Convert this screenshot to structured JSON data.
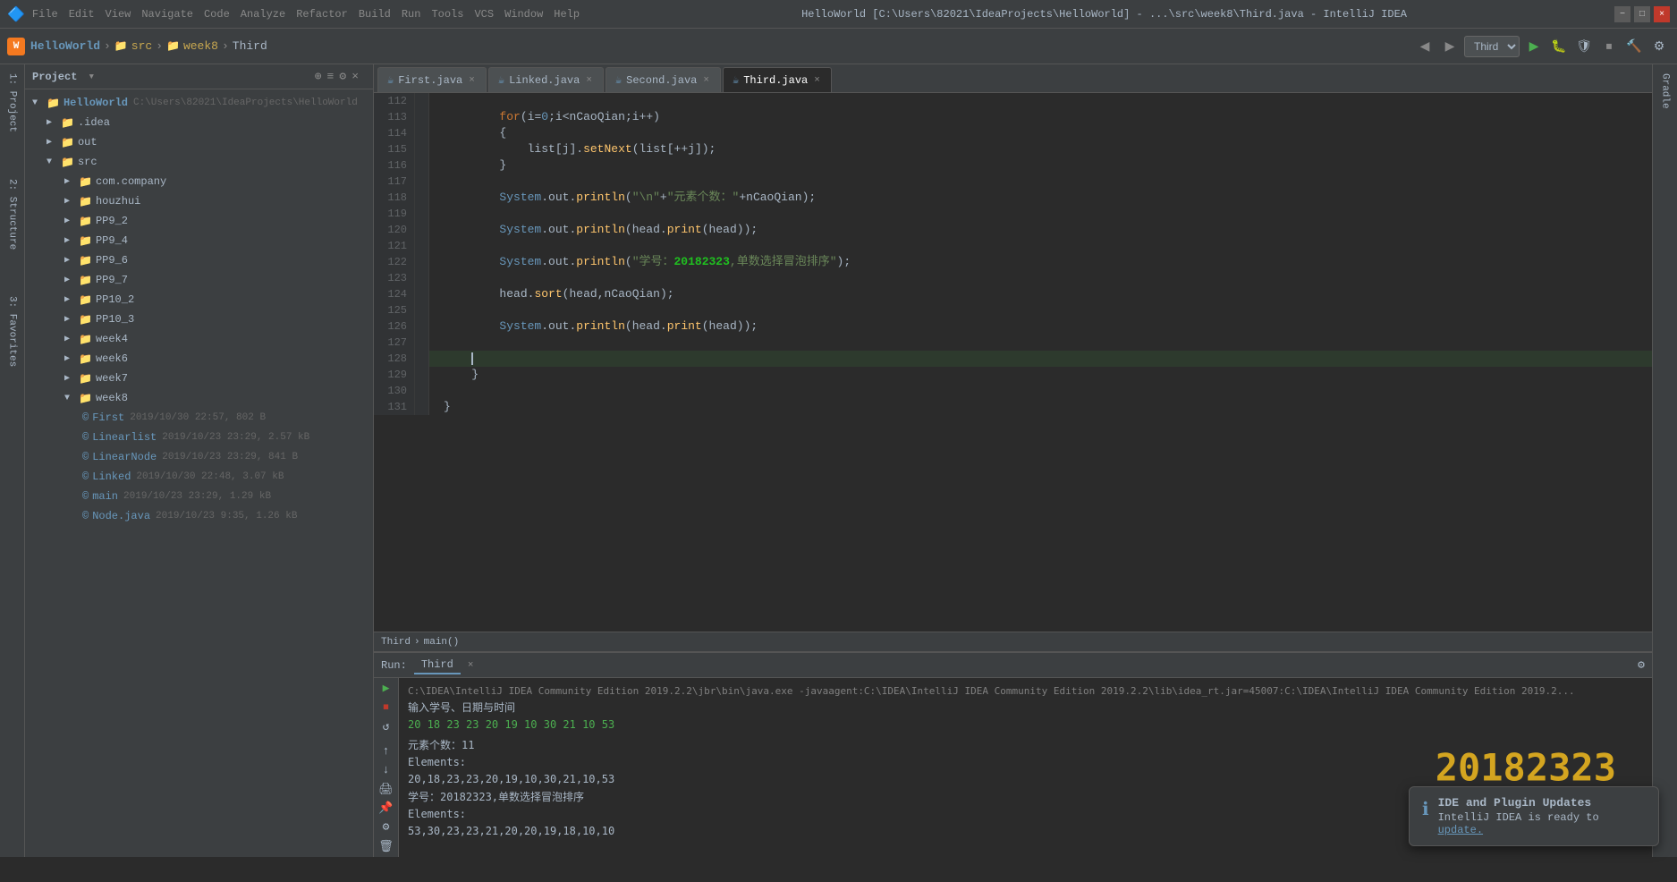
{
  "titlebar": {
    "title": "HelloWorld [C:\\Users\\82021\\IdeaProjects\\HelloWorld] - ...\\src\\week8\\Third.java - IntelliJ IDEA",
    "minimize": "−",
    "maximize": "□",
    "close": "×"
  },
  "toolbar": {
    "app_name": "HelloWorld",
    "breadcrumb": [
      "src",
      "week8",
      "Third"
    ],
    "run_config": "Third",
    "menu": [
      "File",
      "Edit",
      "View",
      "Navigate",
      "Code",
      "Analyze",
      "Refactor",
      "Build",
      "Run",
      "Tools",
      "VCS",
      "Window",
      "Help"
    ]
  },
  "sidebar": {
    "title": "Project",
    "tree": [
      {
        "level": 0,
        "type": "root",
        "label": "HelloWorld",
        "sublabel": "C:\\Users\\82021\\IdeaProjects\\HelloWorld",
        "icon": "folder",
        "expanded": true
      },
      {
        "level": 1,
        "type": "folder",
        "label": ".idea",
        "icon": "folder",
        "expanded": false
      },
      {
        "level": 1,
        "type": "folder",
        "label": "out",
        "icon": "folder",
        "expanded": false
      },
      {
        "level": 1,
        "type": "folder",
        "label": "src",
        "icon": "folder",
        "expanded": true
      },
      {
        "level": 2,
        "type": "folder",
        "label": "com.company",
        "icon": "folder",
        "expanded": false
      },
      {
        "level": 2,
        "type": "folder",
        "label": "houzhui",
        "icon": "folder",
        "expanded": false
      },
      {
        "level": 2,
        "type": "folder",
        "label": "PP9_2",
        "icon": "folder",
        "expanded": false
      },
      {
        "level": 2,
        "type": "folder",
        "label": "PP9_4",
        "icon": "folder",
        "expanded": false
      },
      {
        "level": 2,
        "type": "folder",
        "label": "PP9_6",
        "icon": "folder",
        "expanded": false
      },
      {
        "level": 2,
        "type": "folder",
        "label": "PP9_7",
        "icon": "folder",
        "expanded": false
      },
      {
        "level": 2,
        "type": "folder",
        "label": "PP10_2",
        "icon": "folder",
        "expanded": false
      },
      {
        "level": 2,
        "type": "folder",
        "label": "PP10_3",
        "icon": "folder",
        "expanded": false
      },
      {
        "level": 2,
        "type": "folder",
        "label": "week4",
        "icon": "folder",
        "expanded": false
      },
      {
        "level": 2,
        "type": "folder",
        "label": "week6",
        "icon": "folder",
        "expanded": false
      },
      {
        "level": 2,
        "type": "folder",
        "label": "week7",
        "icon": "folder",
        "expanded": false
      },
      {
        "level": 2,
        "type": "folder",
        "label": "week8",
        "icon": "folder",
        "expanded": true
      },
      {
        "level": 3,
        "type": "class",
        "label": "First",
        "meta": "2019/10/30 22:57, 802 B",
        "color": "blue"
      },
      {
        "level": 3,
        "type": "class",
        "label": "Linearlist",
        "meta": "2019/10/23 23:29, 2.57 kB",
        "color": "blue"
      },
      {
        "level": 3,
        "type": "class",
        "label": "LinearNode",
        "meta": "2019/10/23 23:29, 841 B",
        "color": "blue"
      },
      {
        "level": 3,
        "type": "class",
        "label": "Linked",
        "meta": "2019/10/30 22:48, 3.07 kB",
        "color": "blue"
      },
      {
        "level": 3,
        "type": "class",
        "label": "main",
        "meta": "2019/10/23 23:29, 1.29 kB",
        "color": "blue"
      },
      {
        "level": 3,
        "type": "class",
        "label": "Node.java",
        "meta": "2019/10/23 9:35, 1.26 kB",
        "color": "blue"
      }
    ]
  },
  "tabs": [
    {
      "label": "First.java",
      "active": false,
      "color": "blue"
    },
    {
      "label": "Linked.java",
      "active": false,
      "color": "blue"
    },
    {
      "label": "Second.java",
      "active": false,
      "color": "blue"
    },
    {
      "label": "Third.java",
      "active": true,
      "color": "blue"
    }
  ],
  "code": {
    "lines": [
      {
        "num": 112,
        "content": "",
        "type": "blank"
      },
      {
        "num": 113,
        "content": "        for(i=0;i<nCaoQian;i++)",
        "type": "code"
      },
      {
        "num": 114,
        "content": "        {",
        "type": "code"
      },
      {
        "num": 115,
        "content": "            list[j].setNext(list[++j]);",
        "type": "code"
      },
      {
        "num": 116,
        "content": "        }",
        "type": "code"
      },
      {
        "num": 117,
        "content": "",
        "type": "blank"
      },
      {
        "num": 118,
        "content": "        System.out.println(\"\\n\"+\"元素个数：\"+nCaoQian);",
        "type": "code"
      },
      {
        "num": 119,
        "content": "",
        "type": "blank"
      },
      {
        "num": 120,
        "content": "        System.out.println(head.print(head));",
        "type": "code"
      },
      {
        "num": 121,
        "content": "",
        "type": "blank"
      },
      {
        "num": 122,
        "content": "        System.out.println(\"学号：20182323,单数选择冒泡排序\");",
        "type": "code"
      },
      {
        "num": 123,
        "content": "",
        "type": "blank"
      },
      {
        "num": 124,
        "content": "        head.sort(head,nCaoQian);",
        "type": "code"
      },
      {
        "num": 125,
        "content": "",
        "type": "blank"
      },
      {
        "num": 126,
        "content": "        System.out.println(head.print(head));",
        "type": "code"
      },
      {
        "num": 127,
        "content": "",
        "type": "blank"
      },
      {
        "num": 128,
        "content": "    }",
        "type": "code"
      },
      {
        "num": 129,
        "content": "",
        "type": "blank"
      },
      {
        "num": 130,
        "content": "}",
        "type": "code"
      },
      {
        "num": 131,
        "content": "",
        "type": "blank"
      }
    ]
  },
  "statusbar": {
    "breadcrumb_items": [
      "Third",
      "main()"
    ],
    "sep": "›"
  },
  "run": {
    "label": "Run:",
    "tab_name": "Third",
    "cmd_line": "C:\\IDEA\\IntelliJ IDEA Community Edition 2019.2.2\\jbr\\bin\\java.exe  -javaagent:C:\\IDEA\\IntelliJ IDEA Community Edition 2019.2.2\\lib\\idea_rt.jar=45007:C:\\IDEA\\IntelliJ IDEA Community Edition 2019.2...",
    "prompt": "输入学号、日期与时间",
    "numbers": "20 18 23 23 20 19 10 30 21 10 53",
    "count": "元素个数：11",
    "elements_label1": "Elements:",
    "elements_list1": "20,18,23,23,20,19,10,30,21,10,53",
    "student_line": "学号：20182323,单数选择冒泡排序",
    "elements_label2": "Elements:",
    "elements_list2": "53,30,23,23,21,20,20,19,18,10,10",
    "student_id_display": "20182323"
  },
  "notification": {
    "title": "IDE and Plugin Updates",
    "body": "IntelliJ IDEA is ready to ",
    "link_text": "update."
  }
}
